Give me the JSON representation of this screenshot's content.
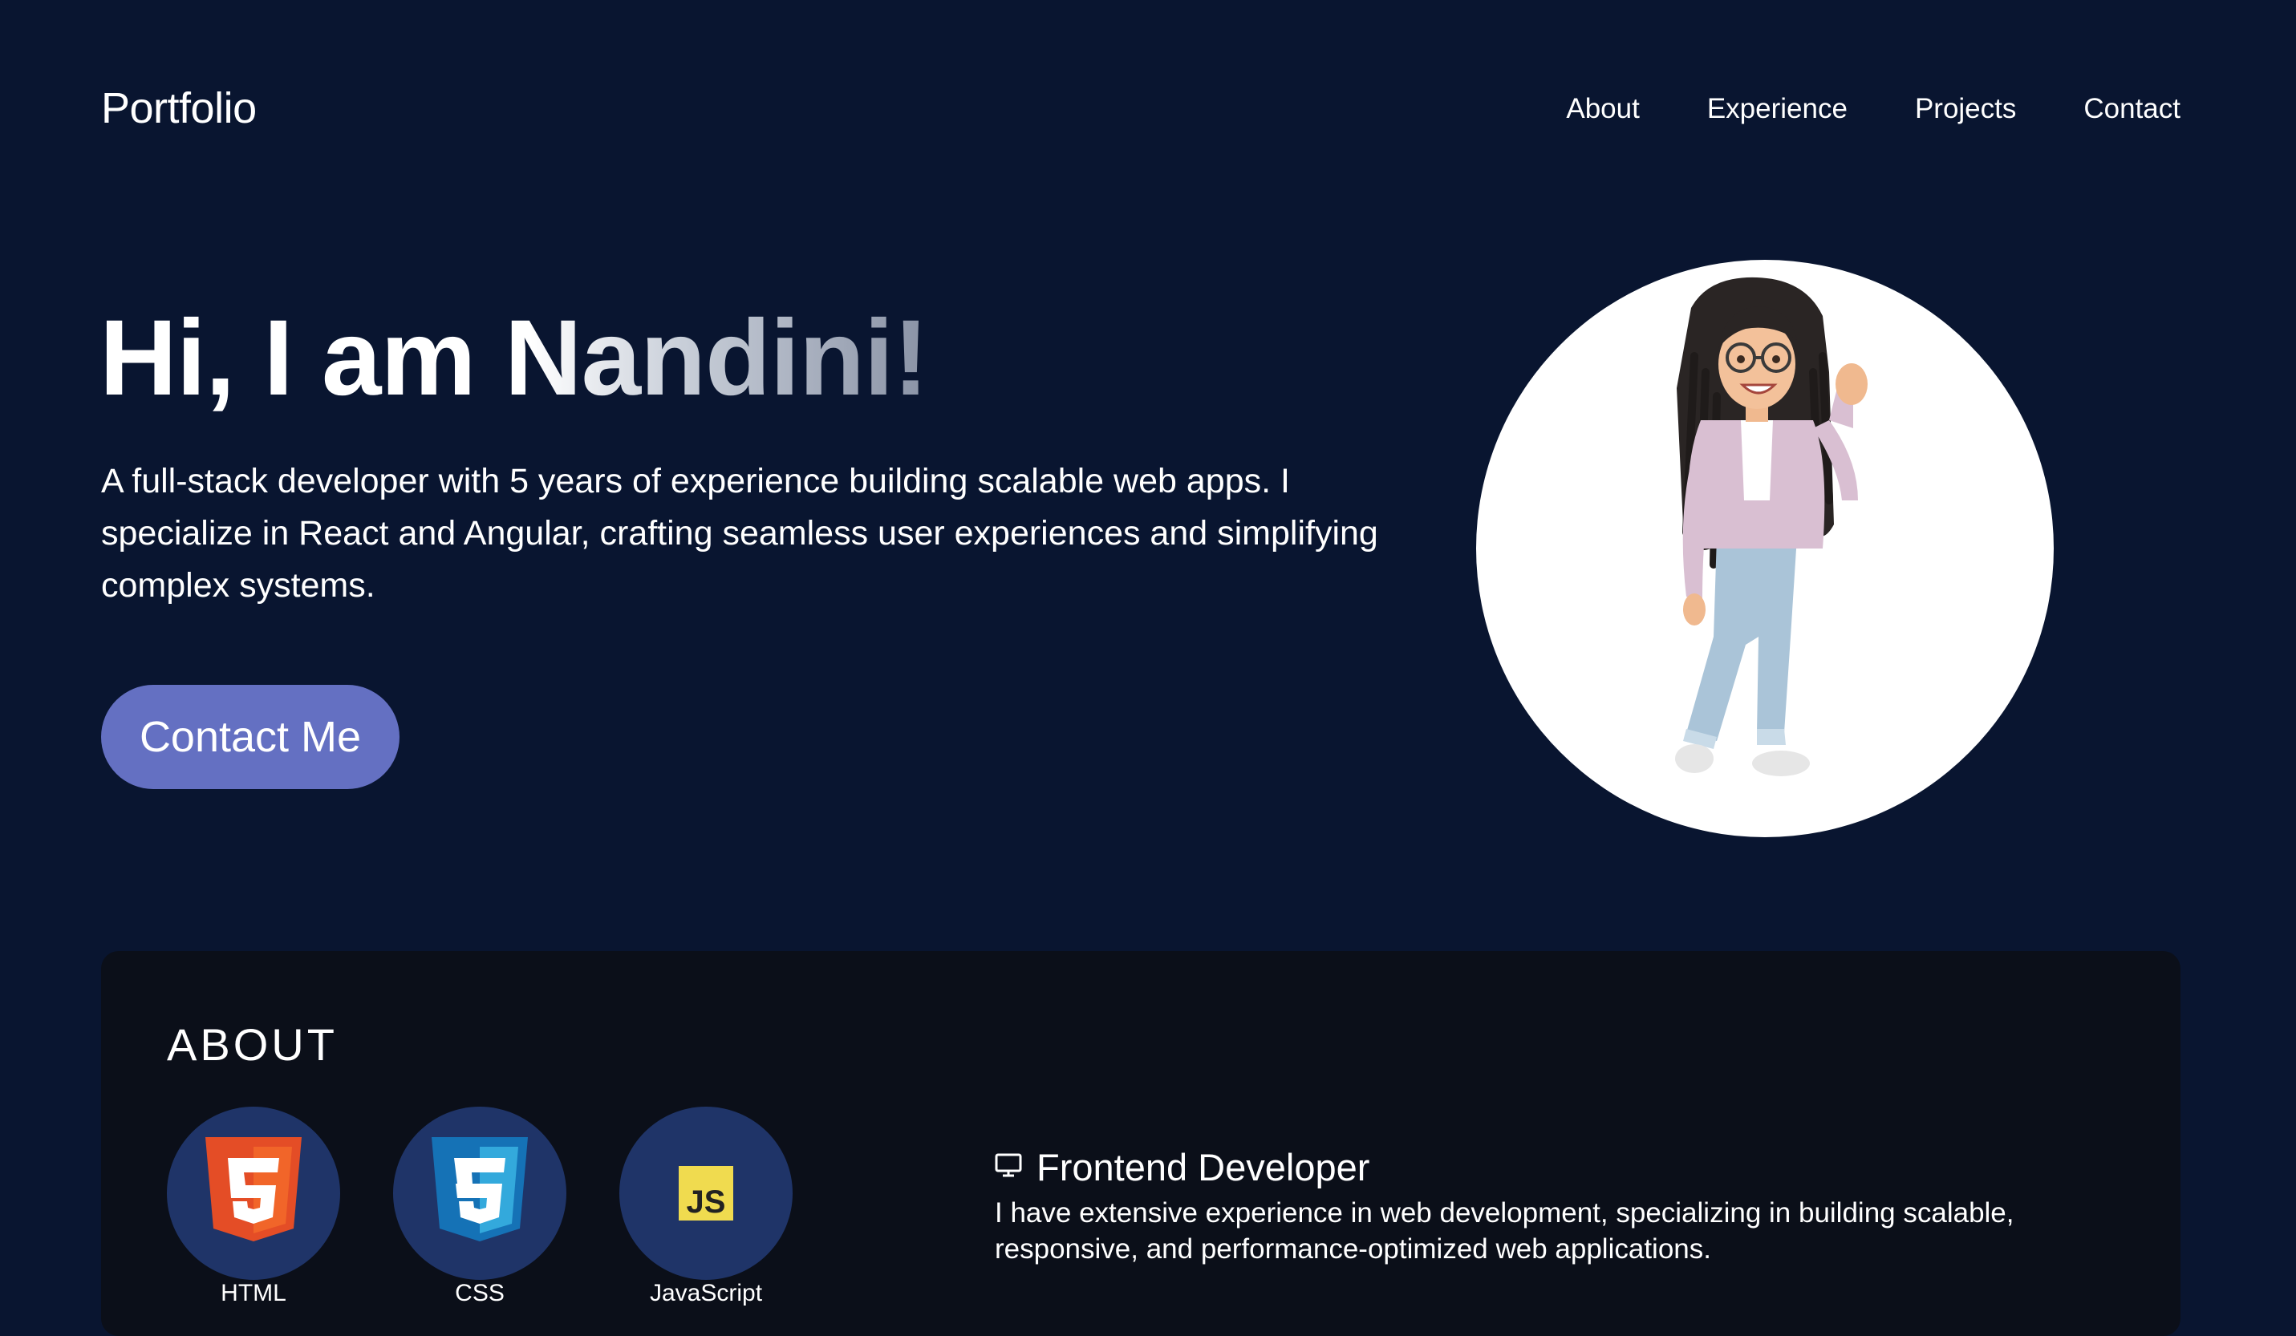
{
  "nav": {
    "brand": "Portfolio",
    "links": [
      {
        "label": "About"
      },
      {
        "label": "Experience"
      },
      {
        "label": "Projects"
      },
      {
        "label": "Contact"
      }
    ]
  },
  "hero": {
    "title": "Hi, I am Nandini!",
    "description": "A full-stack developer with 5 years of experience building scalable web apps. I specialize in React and Angular, crafting seamless user experiences and simplifying complex systems.",
    "cta_label": "Contact Me",
    "avatar": "memoji-avatar-waving"
  },
  "about": {
    "title": "ABOUT",
    "skills": [
      {
        "label": "HTML",
        "icon": "html5-icon"
      },
      {
        "label": "CSS",
        "icon": "css3-icon"
      },
      {
        "label": "JavaScript",
        "icon": "javascript-icon",
        "badge": "JS"
      }
    ],
    "role": {
      "icon": "monitor-icon",
      "title": "Frontend Developer",
      "description": "I have extensive experience in web development, specializing in building scalable, responsive, and performance-optimized web applications."
    }
  },
  "colors": {
    "background": "#091530",
    "card": "#0b0f19",
    "accent_button": "#6470c2",
    "skill_circle": "#1f3468"
  }
}
